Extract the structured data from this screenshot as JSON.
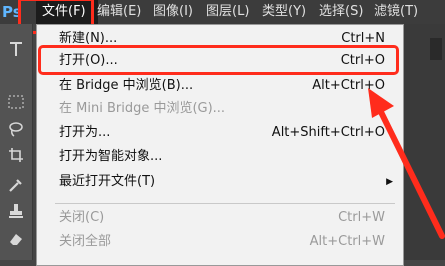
{
  "app": {
    "logo_text": "Ps"
  },
  "menubar": {
    "items": [
      {
        "label": "文件(F)"
      },
      {
        "label": "编辑(E)"
      },
      {
        "label": "图像(I)"
      },
      {
        "label": "图层(L)"
      },
      {
        "label": "类型(Y)"
      },
      {
        "label": "选择(S)"
      },
      {
        "label": "滤镜(T)"
      }
    ]
  },
  "file_menu": {
    "items": [
      {
        "label": "新建(N)...",
        "shortcut": "Ctrl+N",
        "enabled": true
      },
      {
        "label": "打开(O)...",
        "shortcut": "Ctrl+O",
        "enabled": true
      },
      {
        "label": "在 Bridge 中浏览(B)...",
        "shortcut": "Alt+Ctrl+O",
        "enabled": true
      },
      {
        "label": "在 Mini Bridge 中浏览(G)...",
        "shortcut": "",
        "enabled": false
      },
      {
        "label": "打开为...",
        "shortcut": "Alt+Shift+Ctrl+O",
        "enabled": true
      },
      {
        "label": "打开为智能对象...",
        "shortcut": "",
        "enabled": true
      },
      {
        "label": "最近打开文件(T)",
        "shortcut": "",
        "enabled": true,
        "submenu": true
      },
      {
        "label": "关闭(C)",
        "shortcut": "Ctrl+W",
        "enabled": false
      },
      {
        "label": "关闭全部",
        "shortcut": "Alt+Ctrl+W",
        "enabled": false
      }
    ],
    "submenu_arrow": "▶"
  },
  "colors": {
    "highlight": "#ff2c1c",
    "menubar_bg": "#3c3c3c",
    "menu_bg": "#f2f2f2",
    "disabled_text": "#9a9a9a"
  },
  "toolbar": {
    "icons": [
      "type-icon",
      "marquee-icon",
      "lasso-icon",
      "crop-icon",
      "eyedropper-icon",
      "stamp-icon",
      "eraser-icon"
    ]
  }
}
